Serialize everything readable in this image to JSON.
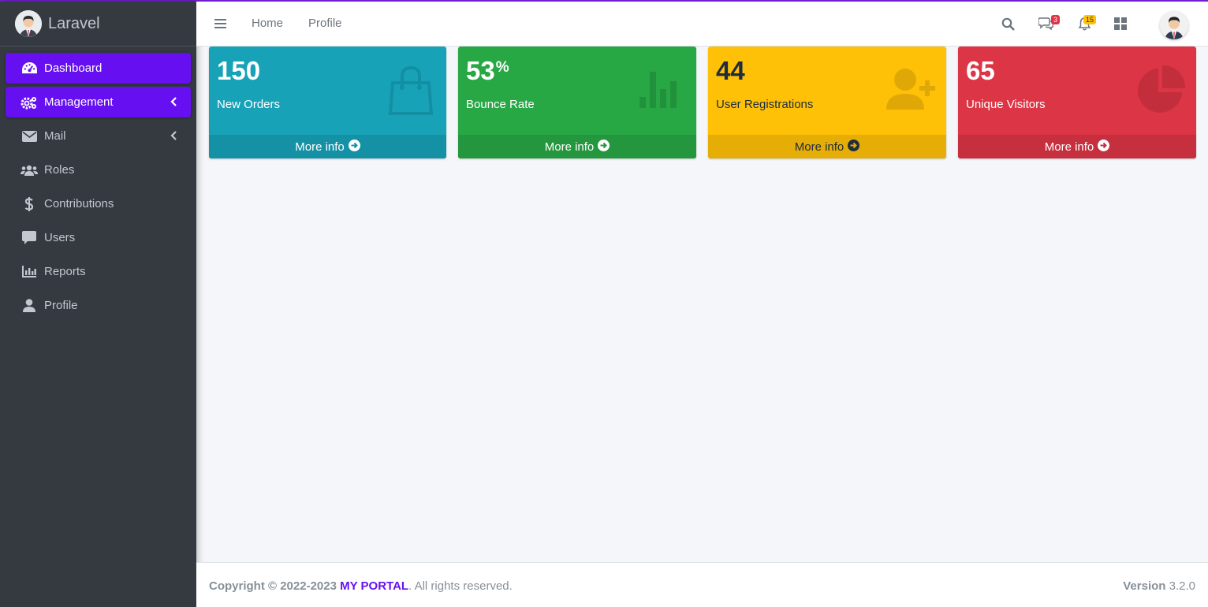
{
  "brand": {
    "name": "Laravel"
  },
  "sidebar": {
    "items": [
      {
        "label": "Dashboard",
        "icon": "dashboard-icon",
        "active": true
      },
      {
        "label": "Management",
        "icon": "cogs-icon",
        "active": true,
        "has_arrow": true
      },
      {
        "label": "Mail",
        "icon": "mail-icon",
        "has_arrow": true
      },
      {
        "label": "Roles",
        "icon": "users-group-icon"
      },
      {
        "label": "Contributions",
        "icon": "dollar-icon"
      },
      {
        "label": "Users",
        "icon": "comment-icon"
      },
      {
        "label": "Reports",
        "icon": "chart-icon"
      },
      {
        "label": "Profile",
        "icon": "user-icon"
      }
    ]
  },
  "header": {
    "links": [
      "Home",
      "Profile"
    ],
    "messages_badge": "3",
    "notifications_badge": "15"
  },
  "boxes": [
    {
      "value": "150",
      "suffix": "",
      "label": "New Orders",
      "footer": "More info",
      "color": "#17a2b8",
      "footer_color": "#1591a5",
      "icon": "shopping-bag-icon"
    },
    {
      "value": "53",
      "suffix": "%",
      "label": "Bounce Rate",
      "footer": "More info",
      "color": "#28a745",
      "footer_color": "#24963e",
      "icon": "bar-chart-icon"
    },
    {
      "value": "44",
      "suffix": "",
      "label": "User Registrations",
      "footer": "More info",
      "color": "#ffc107",
      "footer_color": "#e5ad06",
      "icon": "user-plus-icon"
    },
    {
      "value": "65",
      "suffix": "",
      "label": "Unique Visitors",
      "footer": "More info",
      "color": "#dc3545",
      "footer_color": "#c62f3e",
      "icon": "pie-chart-icon"
    }
  ],
  "footer": {
    "copyright_prefix": "Copyright © 2022-2023",
    "portal_name": "MY PORTAL",
    "suffix": ". All rights reserved.",
    "version_label": "Version",
    "version_value": "3.2.0"
  }
}
